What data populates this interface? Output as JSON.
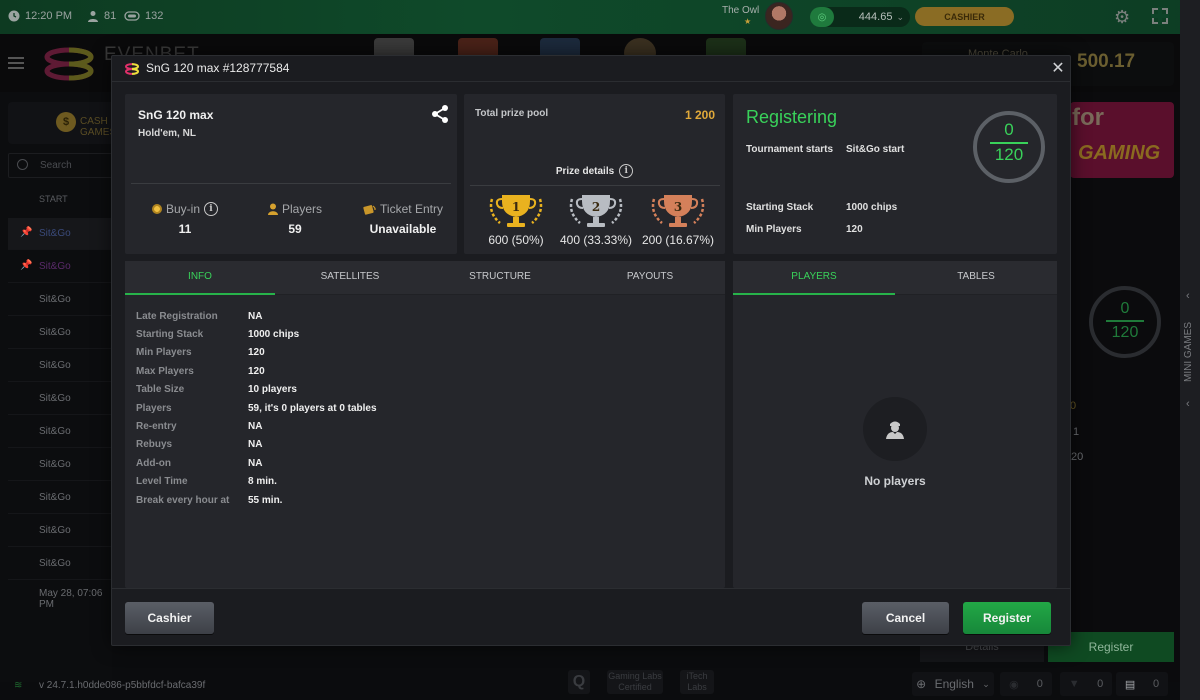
{
  "topbar": {
    "time": "12:20 PM",
    "players_online": "81",
    "tables_count": "132",
    "nickname": "The Owl",
    "balance": "444.65",
    "cashier_label": "CASHIER"
  },
  "brand": {
    "logo_text": "EVENBET"
  },
  "jackpot": {
    "label": "Monte Carlo",
    "value": "500.17"
  },
  "lobby": {
    "tab_label": "CASH GAMES",
    "search_placeholder": "Search",
    "column_start": "START",
    "rows": [
      "Sit&Go",
      "Sit&Go",
      "Sit&Go",
      "Sit&Go",
      "Sit&Go",
      "Sit&Go",
      "Sit&Go",
      "Sit&Go",
      "Sit&Go",
      "Sit&Go",
      "Sit&Go"
    ],
    "last_row": "May 28, 07:06 PM"
  },
  "background_right": {
    "promo_line1": "for",
    "promo_line2": "GAMING",
    "ring_current": "0",
    "ring_total": "120",
    "partial_values": [
      "0",
      "1",
      "20"
    ],
    "details_label": "Details",
    "register_label": "Register"
  },
  "mini_games_label": "MINI GAMES",
  "footer": {
    "version": "v 24.7.1.h0dde086-p5bbfdcf-bafca39f",
    "certs": [
      "Q",
      "Gaming Labs Certified",
      "iTech Labs"
    ],
    "language": "English",
    "counters": [
      "0",
      "0",
      "0"
    ]
  },
  "modal": {
    "title": "SnG 120 max #128777584",
    "close_icon": "close-icon",
    "info_card": {
      "name": "SnG 120 max",
      "game": "Hold'em, NL",
      "buyin_label": "Buy-in",
      "buyin_value": "11",
      "players_label": "Players",
      "players_value": "59",
      "ticket_label": "Ticket Entry",
      "ticket_value": "Unavailable"
    },
    "prize_card": {
      "total_label": "Total prize pool",
      "total_value": "1 200",
      "details_label": "Prize details",
      "places": [
        {
          "place": "1",
          "amount": "600 (50%)",
          "color": "#e9b21f"
        },
        {
          "place": "2",
          "amount": "400 (33.33%)",
          "color": "#b8bcc2"
        },
        {
          "place": "3",
          "amount": "200 (16.67%)",
          "color": "#d4805a"
        }
      ]
    },
    "status_card": {
      "status": "Registering",
      "tournament_starts_label": "Tournament starts",
      "tournament_starts_value": "Sit&Go start",
      "starting_stack_label": "Starting Stack",
      "starting_stack_value": "1000 chips",
      "min_players_label": "Min Players",
      "min_players_value": "120",
      "registered": "0",
      "capacity": "120"
    },
    "left_tabs": [
      "INFO",
      "SATELLITES",
      "STRUCTURE",
      "PAYOUTS"
    ],
    "info_rows": [
      {
        "k": "Late Registration",
        "v": "NA"
      },
      {
        "k": "Starting Stack",
        "v": "1000 chips"
      },
      {
        "k": "Min Players",
        "v": "120"
      },
      {
        "k": "Max Players",
        "v": "120"
      },
      {
        "k": "Table Size",
        "v": "10 players"
      },
      {
        "k": "Players",
        "v": "59, it's 0 players at 0 tables"
      },
      {
        "k": "Re-entry",
        "v": "NA"
      },
      {
        "k": "Rebuys",
        "v": "NA"
      },
      {
        "k": "Add-on",
        "v": "NA"
      },
      {
        "k": "Level Time",
        "v": "8 min."
      },
      {
        "k": "Break every hour at",
        "v": "55 min."
      }
    ],
    "right_tabs": [
      "PLAYERS",
      "TABLES"
    ],
    "empty_players": "No players",
    "buttons": {
      "cashier": "Cashier",
      "cancel": "Cancel",
      "register": "Register"
    }
  },
  "colors": {
    "accent_green": "#39d25a",
    "gold": "#e0a93a",
    "register_button": "#1f9a40"
  }
}
